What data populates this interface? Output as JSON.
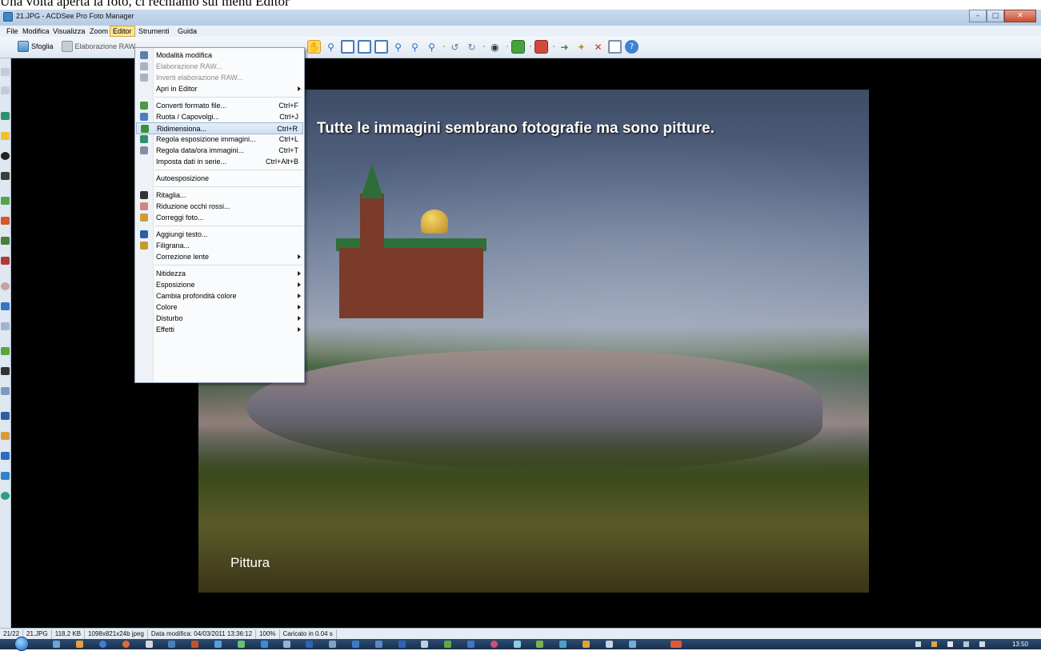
{
  "document_caption": "Una volta aperta la foto, ci rechiamo sul menù Editor",
  "window": {
    "title": "21.JPG - ACDSee Pro Foto Manager"
  },
  "menubar": {
    "file": "File",
    "modifica": "Modifica",
    "visualizza": "Visualizza",
    "zoom": "Zoom",
    "editor": "Editor",
    "strumenti": "Strumenti",
    "guida": "Guida"
  },
  "toolbar": {
    "browse_label": "Sfoglia",
    "raw_label": "Elaborazione RAW"
  },
  "editor_menu": [
    {
      "label": "Modalità modifica",
      "shortcut": "",
      "state": "normal",
      "icon": "edit-mode-icon"
    },
    {
      "label": "Elaborazione RAW...",
      "shortcut": "",
      "state": "disabled",
      "icon": "raw-icon"
    },
    {
      "label": "Inverti elaborazione RAW...",
      "shortcut": "",
      "state": "disabled",
      "icon": "raw-revert-icon"
    },
    {
      "label": "Apri in Editor",
      "shortcut": "",
      "state": "submenu",
      "icon": ""
    },
    {
      "separator": true
    },
    {
      "label": "Converti formato file...",
      "shortcut": "Ctrl+F",
      "state": "normal",
      "icon": "convert-icon"
    },
    {
      "label": "Ruota / Capovolgi...",
      "shortcut": "Ctrl+J",
      "state": "normal",
      "icon": "rotate-icon"
    },
    {
      "label": "Ridimensiona...",
      "shortcut": "Ctrl+R",
      "state": "highlighted",
      "icon": "resize-icon"
    },
    {
      "label": "Regola esposizione immagini...",
      "shortcut": "Ctrl+L",
      "state": "normal",
      "icon": "exposure-icon"
    },
    {
      "label": "Regola data/ora immagini...",
      "shortcut": "Ctrl+T",
      "state": "normal",
      "icon": "datetime-icon"
    },
    {
      "label": "Imposta dati in serie...",
      "shortcut": "Ctrl+Alt+B",
      "state": "normal",
      "icon": ""
    },
    {
      "separator": true
    },
    {
      "label": "Autoesposizione",
      "shortcut": "",
      "state": "normal",
      "icon": ""
    },
    {
      "separator": true
    },
    {
      "label": "Ritaglia...",
      "shortcut": "",
      "state": "normal",
      "icon": "crop-icon"
    },
    {
      "label": "Riduzione occhi rossi...",
      "shortcut": "",
      "state": "normal",
      "icon": "red-eye-icon"
    },
    {
      "label": "Correggi foto...",
      "shortcut": "",
      "state": "normal",
      "icon": "fix-photo-icon"
    },
    {
      "separator": true
    },
    {
      "label": "Aggiungi testo...",
      "shortcut": "",
      "state": "normal",
      "icon": "text-icon"
    },
    {
      "label": "Filigrana...",
      "shortcut": "",
      "state": "normal",
      "icon": "watermark-icon"
    },
    {
      "label": "Correzione lente",
      "shortcut": "",
      "state": "submenu",
      "icon": ""
    },
    {
      "separator": true
    },
    {
      "label": "Nitidezza",
      "shortcut": "",
      "state": "submenu",
      "icon": ""
    },
    {
      "label": "Esposizione",
      "shortcut": "",
      "state": "submenu",
      "icon": ""
    },
    {
      "label": "Cambia profondità colore",
      "shortcut": "",
      "state": "submenu",
      "icon": ""
    },
    {
      "label": "Colore",
      "shortcut": "",
      "state": "submenu",
      "icon": ""
    },
    {
      "label": "Disturbo",
      "shortcut": "",
      "state": "submenu",
      "icon": ""
    },
    {
      "label": "Effetti",
      "shortcut": "",
      "state": "submenu",
      "icon": ""
    }
  ],
  "photo": {
    "caption_top": "Tutte le immagini sembrano fotografie ma sono pitture.",
    "caption_bottom": "Pittura"
  },
  "statusbar": {
    "index": "21/22",
    "filename": "21.JPG",
    "filesize": "118,2 KB",
    "dimensions": "1098x821x24b jpeg",
    "modified": "Data modifica: 04/03/2011 13:36:12",
    "zoom": "100%",
    "load_time": "Caricato in 0.04 s"
  },
  "taskbar": {
    "clock": "13:50"
  },
  "colors": {
    "accent": "#fbe39b",
    "menu_highlight": "#cfe0f3",
    "viewer_bg": "#000000",
    "titlebar": "#c9dbee"
  }
}
